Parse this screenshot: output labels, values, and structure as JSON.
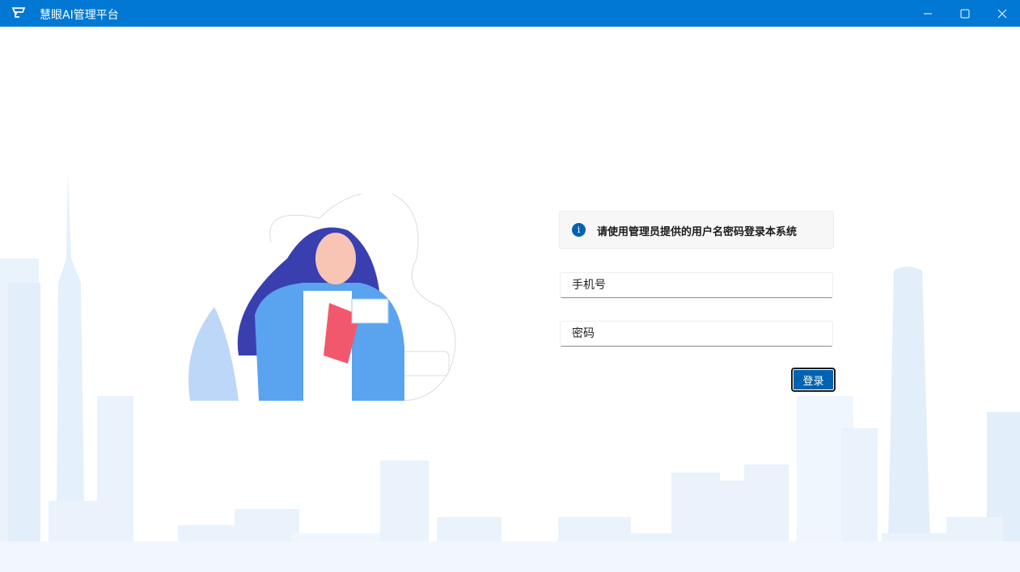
{
  "window": {
    "title": "慧眼AI管理平台",
    "minimize_icon": "minimize-icon",
    "maximize_icon": "maximize-icon",
    "close_icon": "close-icon"
  },
  "login": {
    "notice": "请使用管理员提供的用户名密码登录本系统",
    "phone_placeholder": "手机号",
    "password_placeholder": "密码",
    "submit_label": "登录"
  },
  "colors": {
    "titlebar": "#0078d4",
    "accent": "#0063b1"
  }
}
